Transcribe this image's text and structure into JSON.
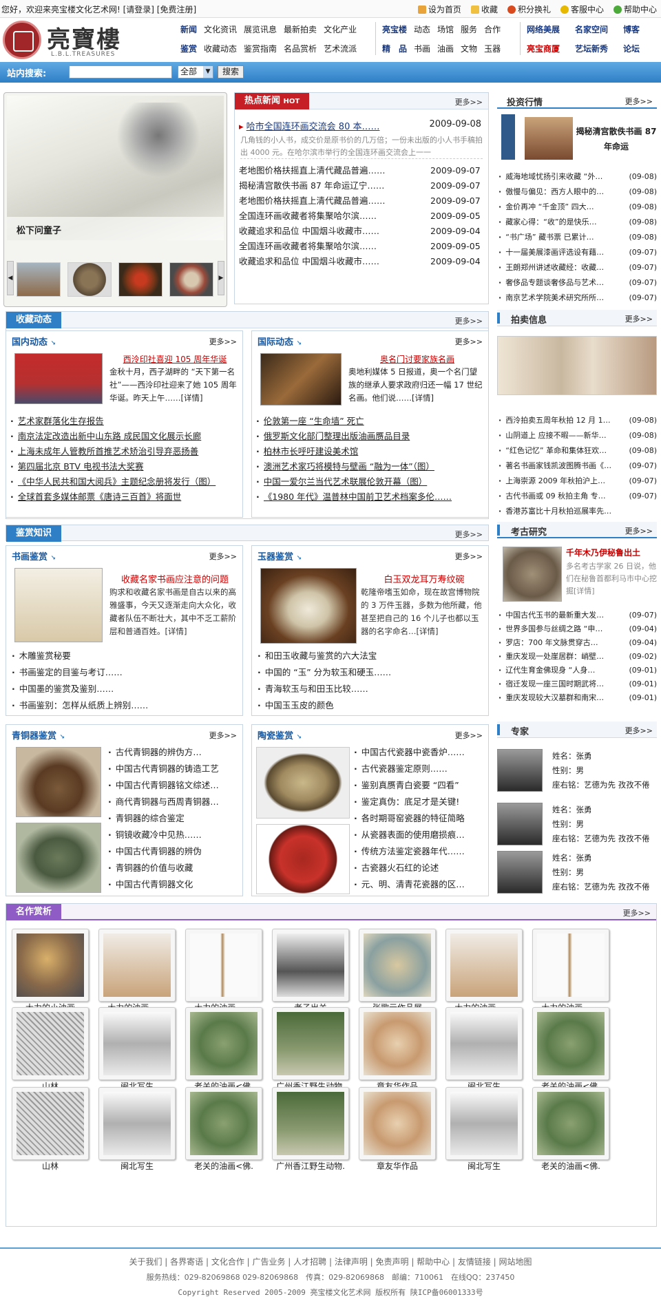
{
  "topbar": {
    "welcome": "您好，欢迎来亮宝楼文化艺术网! [请登录] [免费注册]",
    "links": [
      "设为首页",
      "收藏",
      "积分换礼",
      "客服中心",
      "帮助中心"
    ]
  },
  "logo": {
    "name": "亮寶樓",
    "sub": "L.B.L.TREASURES"
  },
  "nav": {
    "g1": {
      "r1": [
        "新闻",
        "文化资讯",
        "展览讯息",
        "最新拍卖",
        "文化产业"
      ],
      "r2": [
        "鉴赏",
        "收藏动态",
        "鉴赏指南",
        "名品赏析",
        "艺术流派"
      ]
    },
    "g2": {
      "r1": [
        "亮宝楼",
        "动态",
        "场馆",
        "服务",
        "合作"
      ],
      "r2": [
        "精　品",
        "书画",
        "油画",
        "文物",
        "玉器"
      ]
    },
    "g3": {
      "r1": [
        "网络美展",
        "名家空间",
        "博客"
      ],
      "r2": [
        "亮宝商厦",
        "艺坛新秀",
        "论坛"
      ]
    }
  },
  "search": {
    "label": "站内搜索:",
    "select": "全部",
    "button": "搜索"
  },
  "slider": {
    "caption": "松下问童子"
  },
  "hot": {
    "title": "热点新闻",
    "tag": "HOT",
    "more": "更多>>",
    "lead": {
      "title": "哈市全国连环画交流会 80 本……",
      "date": "2009-09-08",
      "desc": "几角钱的小人书，成交价是原书价的几万倍；一份未出版的小人书手稿拍出 4000 元。在哈尔滨市举行的全国连环画交流会上一一"
    },
    "items": [
      [
        "老地图价格扶摇直上清代藏品普遍……",
        "2009-09-07"
      ],
      [
        "揭秘清宫散佚书画 87 年命运辽宁……",
        "2009-09-07"
      ],
      [
        "老地图价格扶摇直上清代藏品普遍……",
        "2009-09-07"
      ],
      [
        "全国连环画收藏者将集聚哈尔滨……",
        "2009-09-05"
      ],
      [
        "收藏追求和品位 中国烟斗收藏市……",
        "2009-09-04"
      ],
      [
        "全国连环画收藏者将集聚哈尔滨……",
        "2009-09-05"
      ],
      [
        "收藏追求和品位 中国烟斗收藏市……",
        "2009-09-04"
      ]
    ]
  },
  "invest": {
    "title": "投资行情",
    "more": "更多>>",
    "lead": "揭秘清宫散佚书画 87 年命运",
    "items": [
      [
        "威海地域忧扬引来收藏 “外…",
        "(09-08)"
      ],
      [
        "傲慢与偏见：西方人眼中的…",
        "(09-08)"
      ],
      [
        "金价再冲 “千金顶” 四大…",
        "(09-08)"
      ],
      [
        "藏家心得：“收”的是快乐…",
        "(09-08)"
      ],
      [
        "“书广场” 藏书票 已累计…",
        "(09-08)"
      ],
      [
        "十一届美展漆画评选设有藉…",
        "(09-07)"
      ],
      [
        "王朗郑州讲述收藏经：收藏…",
        "(09-07)"
      ],
      [
        "奢侈品专题谈奢侈品与艺术…",
        "(09-07)"
      ],
      [
        "南京艺术学院美术研究所所…",
        "(09-07)"
      ]
    ]
  },
  "collect": {
    "title": "收藏动态",
    "more": "更多>>",
    "domestic": {
      "title": "国内动态",
      "more": "更多>>",
      "lead": "西泠印社喜迎 105 周年华诞",
      "desc": "金秋十月，西子湖畔的 “天下第一名社”——西泠印社迎来了她 105 周年华诞。昨天上午……[详情]",
      "items": [
        "艺术家群落化生存报告",
        "南京法定改造出新中山东路 成民国文化展示长廊",
        "上海未成年人管教所首推艺术矫治引导弃恶扬善",
        "第四届北京 BTV 电视书法大奖赛",
        "《中华人民共和国大阅兵》主题纪念册将发行（图）",
        "全球首套多媒体邮票《唐诗三百首》将面世"
      ]
    },
    "intl": {
      "title": "国际动态",
      "more": "更多>>",
      "lead": "奥名门讨要家族名画",
      "desc": "奥地利媒体 5 日报道，奥一个名门望族的继承人要求政府归还一幅 17 世纪名画。他们说……[详情]",
      "items": [
        "伦敦第一座 “生命墙” 死亡",
        "俄罗斯文化部门整理出版油画赝品目录",
        "柏林市长呼吁建设美术馆",
        "澳洲艺术家巧将模特与壁画 “融为一体”（图）",
        "中国一爱尔兰当代艺术联展伦敦开幕（图）",
        "《1980 年代》温普林中国前卫艺术档案多伦……"
      ]
    }
  },
  "auction": {
    "title": "拍卖信息",
    "more": "更多>>",
    "items": [
      [
        "西泠拍卖五周年秋拍 12 月 1…",
        "(09-08)"
      ],
      [
        "山阴道上 应接不暇——新华…",
        "(09-08)"
      ],
      [
        "“红色记忆” 革命和集体狂欢…",
        "(09-08)"
      ],
      [
        "著名书画家钱凯波图腾书画《…",
        "(09-07)"
      ],
      [
        "上海崇源 2009 年秋拍沪上…",
        "(09-07)"
      ],
      [
        "古代书画或 09 秋拍主角 专…",
        "(09-07)"
      ],
      [
        "香港苏富比十月秋拍巡展率先…",
        ""
      ]
    ]
  },
  "jianshang": {
    "title": "鉴赏知识",
    "more": "更多>>",
    "calli": {
      "title": "书画鉴赏",
      "more": "更多>>",
      "lead": "收藏名家书画应注意的问题",
      "desc": "购求和收藏名家书画是自古以来的高雅盛事，今天又逐渐走向大众化，收藏者队伍不断壮大，其中不乏工薪阶层和普通百姓。[详情]",
      "items": [
        "木雕鉴赏秘要",
        "书画鉴定的目鉴与考订……",
        "中国墨的鉴赏及鉴别……",
        "书画鉴别：怎样从纸质上辨别……"
      ]
    },
    "jade": {
      "title": "玉器鉴赏",
      "more": "更多>>",
      "lead": "白玉双龙耳万寿纹碗",
      "desc": "乾隆帝嗜玉如命，现在故宫博物院的 3 万件玉器，多数为他所藏，他甚至把自己的 16 个儿子也都以玉器的名字命名…[详情]",
      "items": [
        "和田玉收藏与鉴赏的六大法宝",
        "中国的 “玉” 分为软玉和硬玉……",
        "青海软玉与和田玉比较……",
        "中国玉玉皮的颜色"
      ]
    },
    "bronze": {
      "title": "青铜器鉴赏",
      "more": "更多>>",
      "items": [
        "古代青铜器的辨伪方…",
        "中国古代青铜器的铸造工艺",
        "中国古代青铜器铭文综述…",
        "商代青铜器与西周青铜器…",
        "青铜器的综合鉴定",
        "铜镜收藏冷中见热……",
        "中国古代青铜器的辨伪",
        "青铜器的价值与收藏",
        "中国古代青铜器文化"
      ]
    },
    "ceramic": {
      "title": "陶瓷鉴赏",
      "more": "更多>>",
      "items": [
        "中国古代瓷器中瓷香炉……",
        "古代瓷器鉴定原则……",
        "鉴别真赝青白瓷要 “四看”",
        "鉴定真伪：底足才是关键!",
        "各时期哥窑瓷器的特征简略",
        "从瓷器表面的使用磨损痕…",
        "传统方法鉴定瓷器年代……",
        "古瓷器火石红的论述",
        "元、明、清青花瓷器的区…"
      ]
    }
  },
  "archaeo": {
    "title": "考古研究",
    "more": "更多>>",
    "lead": "千年木乃伊秘鲁出土",
    "desc": "多名考古学家 26 日说，他们在秘鲁首都利马市中心挖掘[详情]",
    "items": [
      [
        "中国古代玉书的最新重大发…",
        "(09-07)"
      ],
      [
        "世界多国参与丝绸之路 “申…",
        "(09-04)"
      ],
      [
        "罗店：700 年文脉贯穿古…",
        "(09-04)"
      ],
      [
        "重庆发现一处崖居群：峭壁…",
        "(09-02)"
      ],
      [
        "辽代生育金佛现身 “人身…",
        "(09-01)"
      ],
      [
        "宿迁发现一座三国时期武将…",
        "(09-01)"
      ],
      [
        "重庆发现较大汉墓群和南宋…",
        "(09-01)"
      ]
    ]
  },
  "experts": {
    "title": "专家",
    "more": "更多>>",
    "list": [
      {
        "name": "姓名：张勇",
        "gender": "性别：男",
        "motto": "座右铭：艺德为先 孜孜不倦"
      },
      {
        "name": "姓名：张勇",
        "gender": "性别：男",
        "motto": "座右铭：艺德为先 孜孜不倦"
      },
      {
        "name": "姓名：张勇",
        "gender": "性别：男",
        "motto": "座右铭：艺德为先 孜孜不倦"
      }
    ]
  },
  "gallery": {
    "title": "名作赏析",
    "more": "更多>>",
    "rows": [
      [
        "大力的小油画",
        "大力的油画-----.",
        "大力的油画-----.",
        "老子出关",
        "张歌元作品展",
        "大力的油画-----.",
        "大力的油画-----."
      ],
      [
        "山林",
        "闽北写生",
        "老关的油画<佛.",
        "广州香江野生动物.",
        "章友华作品",
        "闽北写生",
        "老关的油画<佛."
      ],
      [
        "山林",
        "闽北写生",
        "老关的油画<佛.",
        "广州香江野生动物.",
        "章友华作品",
        "闽北写生",
        "老关的油画<佛."
      ]
    ]
  },
  "footer": {
    "links": "关于我们 | 各界寄语 | 文化合作 | 广告业务 | 人才招聘 | 法律声明 | 免责声明 | 帮助中心 | 友情链接 | 网站地图",
    "contact": "服务热线：029-82069868 029-82069868　传真：029-82069868　邮编：710061　在线QQ：237450",
    "copy": "Copyright Reserved 2005-2009 亮宝楼文化艺术网 版权所有 陕ICP备06001333号"
  },
  "colors": {
    "blue": "#2f7fc6",
    "red": "#c62026",
    "purple": "#8e5cc4",
    "navblue": "#1a3a80"
  }
}
